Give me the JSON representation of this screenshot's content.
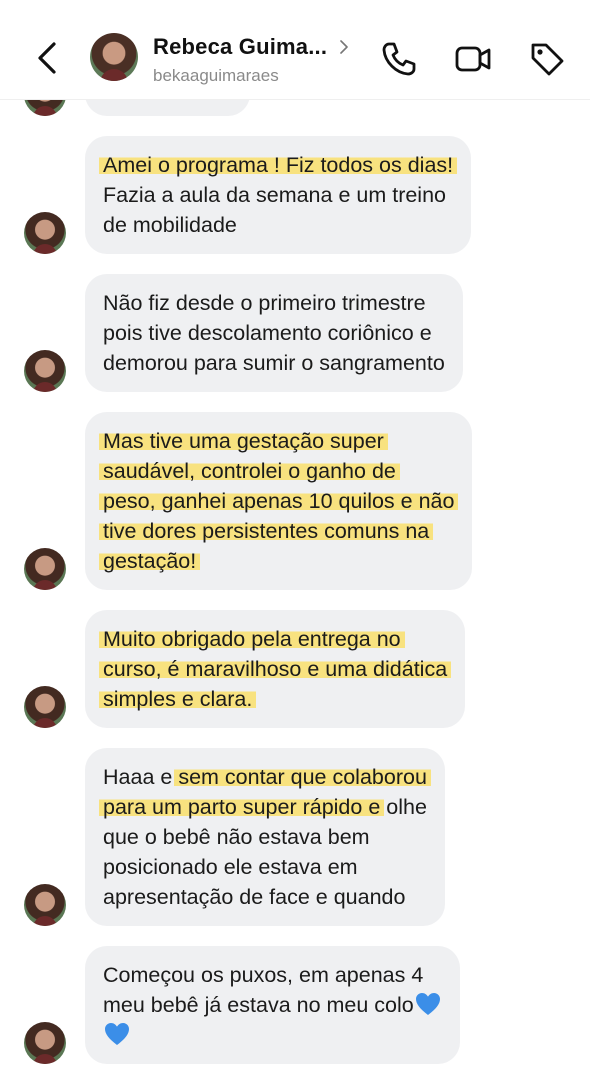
{
  "header": {
    "name": "Rebeca Guima...",
    "username": "bekaaguimaraes"
  },
  "messages": [
    {
      "lines": [
        {
          "segs": [
            {
              "t": "Amei o programa ! Fiz todos os dias!",
              "hl": true
            }
          ]
        },
        {
          "segs": [
            {
              "t": "Fazia a aula da semana e um treino",
              "hl": false
            }
          ]
        },
        {
          "segs": [
            {
              "t": "de mobilidade",
              "hl": false
            }
          ]
        }
      ]
    },
    {
      "lines": [
        {
          "segs": [
            {
              "t": "Não fiz desde o primeiro trimestre",
              "hl": false
            }
          ]
        },
        {
          "segs": [
            {
              "t": "pois tive descolamento coriônico e",
              "hl": false
            }
          ]
        },
        {
          "segs": [
            {
              "t": "demorou para sumir o sangramento",
              "hl": false
            }
          ]
        }
      ]
    },
    {
      "lines": [
        {
          "segs": [
            {
              "t": "Mas tive uma gestação super",
              "hl": true
            }
          ]
        },
        {
          "segs": [
            {
              "t": "saudável, controlei o ganho de",
              "hl": true
            }
          ]
        },
        {
          "segs": [
            {
              "t": "peso, ganhei apenas 10 quilos e não",
              "hl": true
            }
          ]
        },
        {
          "segs": [
            {
              "t": "tive dores persistentes comuns na",
              "hl": true
            }
          ]
        },
        {
          "segs": [
            {
              "t": "gestação!",
              "hl": true
            }
          ]
        }
      ]
    },
    {
      "lines": [
        {
          "segs": [
            {
              "t": "Muito obrigado pela entrega no",
              "hl": true
            }
          ]
        },
        {
          "segs": [
            {
              "t": "curso, é maravilhoso e uma didática",
              "hl": true
            }
          ]
        },
        {
          "segs": [
            {
              "t": "simples e clara.",
              "hl": true
            }
          ]
        }
      ]
    },
    {
      "lines": [
        {
          "segs": [
            {
              "t": "Haaa e ",
              "hl": false
            },
            {
              "t": "sem contar que colaborou",
              "hl": true
            }
          ]
        },
        {
          "segs": [
            {
              "t": "para um parto  super rápido e",
              "hl": true
            },
            {
              "t": " olhe",
              "hl": false
            }
          ]
        },
        {
          "segs": [
            {
              "t": "que o bebê não estava bem",
              "hl": false
            }
          ]
        },
        {
          "segs": [
            {
              "t": "posicionado ele estava em",
              "hl": false
            }
          ]
        },
        {
          "segs": [
            {
              "t": "apresentação de face e quando",
              "hl": false
            }
          ]
        }
      ]
    },
    {
      "lines": [
        {
          "segs": [
            {
              "t": "Começou os puxos, em apenas 4",
              "hl": false
            }
          ]
        },
        {
          "segs": [
            {
              "t": "meu bebê já estava no meu colo",
              "hl": false
            },
            {
              "t": "",
              "heart": true
            }
          ]
        },
        {
          "segs": [
            {
              "t": "",
              "heart": true
            }
          ]
        }
      ]
    }
  ],
  "colors": {
    "bubble": "#eff0f2",
    "highlight": "#fade5f",
    "heart": "#3b8ee8"
  }
}
